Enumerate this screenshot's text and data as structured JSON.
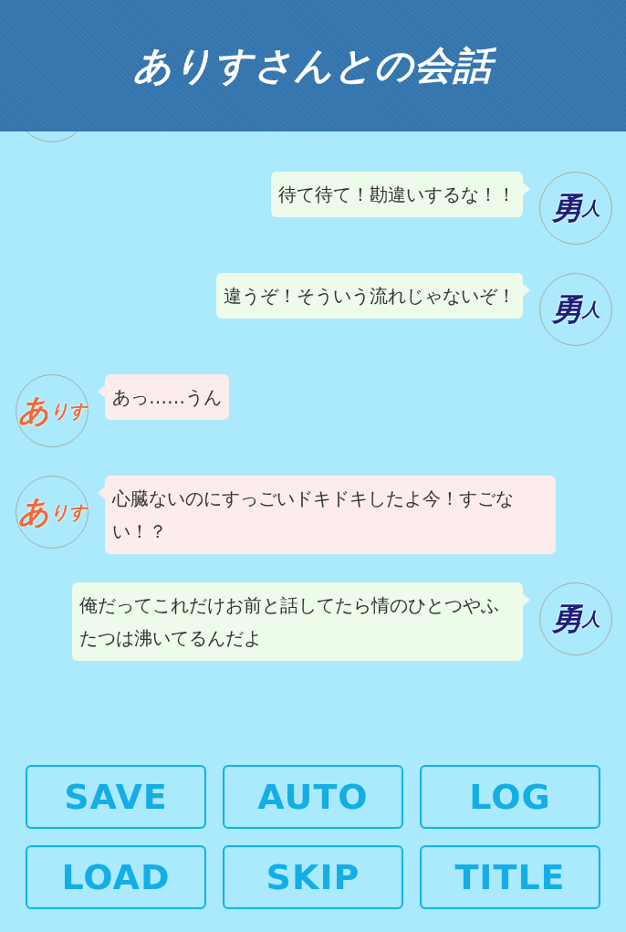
{
  "header": {
    "title": "ありすさんとの会話"
  },
  "messages": [
    {
      "kind": "sent",
      "avatar": {
        "main": "勇",
        "sub": "人",
        "color": "#1f1f7a"
      },
      "text": "待て待て！勘違いするな！！"
    },
    {
      "kind": "sent",
      "avatar": {
        "main": "勇",
        "sub": "人",
        "color": "#1f1f7a"
      },
      "text": "違うぞ！そういう流れじゃないぞ！"
    },
    {
      "kind": "received",
      "avatar": {
        "main": "あ",
        "sub": "りす",
        "color": "#ee6a3c"
      },
      "text": "あっ……うん"
    },
    {
      "kind": "received",
      "avatar": {
        "main": "あ",
        "sub": "りす",
        "color": "#ee6a3c"
      },
      "text": "心臓ないのにすっごいドキドキしたよ今！すごない！？"
    },
    {
      "kind": "sent",
      "avatar": {
        "main": "勇",
        "sub": "人",
        "color": "#1f1f7a"
      },
      "text": "俺だってこれだけお前と話してたら情のひとつやふたつは沸いてるんだよ"
    }
  ],
  "buttons": [
    "SAVE",
    "AUTO",
    "LOG",
    "LOAD",
    "SKIP",
    "TITLE"
  ]
}
